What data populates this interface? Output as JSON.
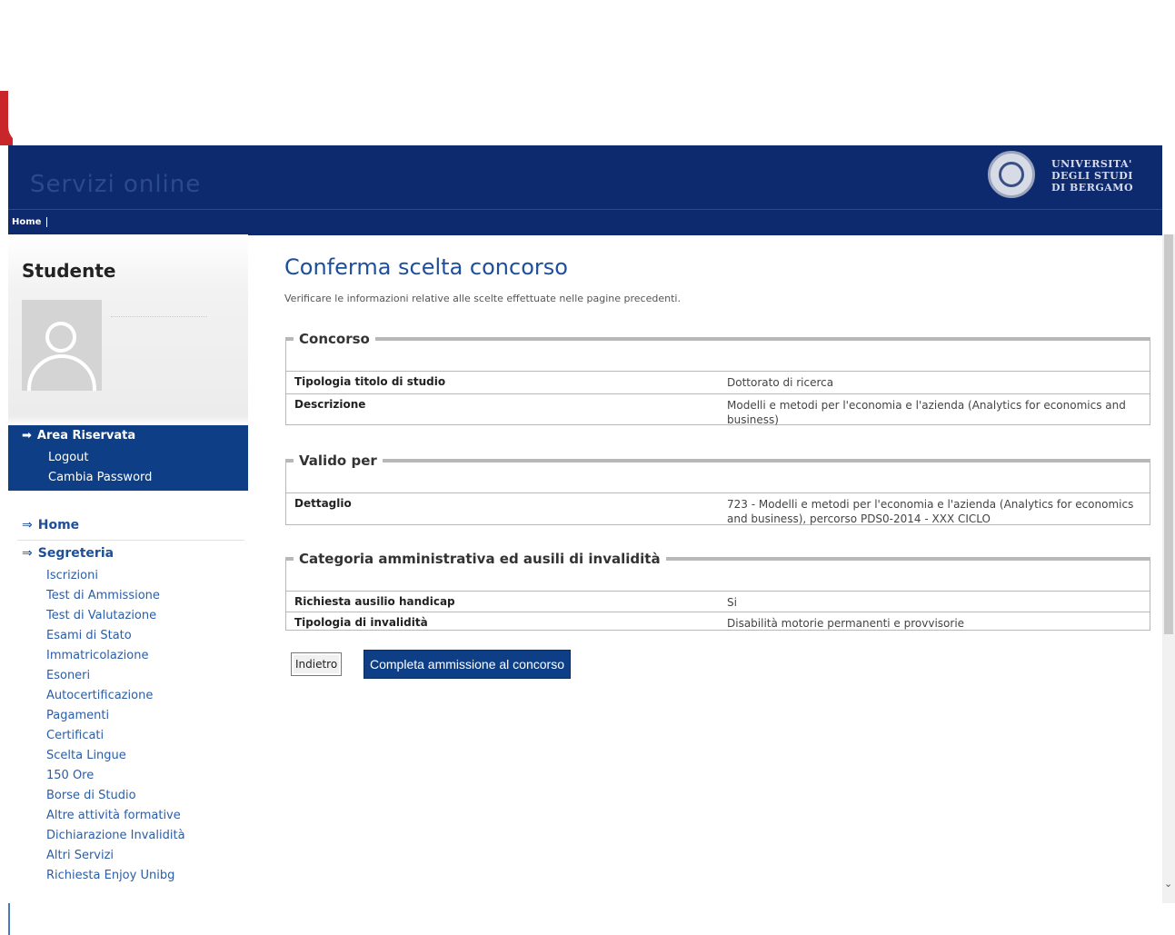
{
  "header": {
    "site_title": "Servizi online",
    "logo_lines": [
      "UNIVERSITA'",
      "DEGLI STUDI",
      "DI BERGAMO"
    ]
  },
  "navbar": {
    "home_label": "Home"
  },
  "sidebar": {
    "title": "Studente",
    "area": {
      "title": "Area Riservata",
      "links": [
        "Logout",
        "Cambia Password"
      ]
    },
    "home_label": "Home",
    "segreteria": {
      "title": "Segreteria",
      "links": [
        "Iscrizioni",
        "Test di Ammissione",
        "Test di Valutazione",
        "Esami di Stato",
        "Immatricolazione",
        "Esoneri",
        "Autocertificazione",
        "Pagamenti",
        "Certificati",
        "Scelta Lingue",
        "150 Ore",
        "Borse di Studio",
        "Altre attività formative",
        "Dichiarazione Invalidità",
        "Altri Servizi",
        "Richiesta Enjoy Unibg"
      ]
    }
  },
  "main": {
    "title": "Conferma scelta concorso",
    "subtitle": "Verificare le informazioni relative alle scelte effettuate nelle pagine precedenti.",
    "sections": [
      {
        "legend": "Concorso",
        "rows": [
          {
            "key": "Tipologia titolo di studio",
            "value": "Dottorato di ricerca"
          },
          {
            "key": "Descrizione",
            "value": "Modelli e metodi per l'economia e l'azienda (Analytics for economics and business)"
          }
        ]
      },
      {
        "legend": "Valido per",
        "rows": [
          {
            "key": "Dettaglio",
            "value": "723 - Modelli e metodi per l'economia e l'azienda (Analytics for economics and business), percorso PDS0-2014 - XXX CICLO"
          }
        ]
      },
      {
        "legend": "Categoria amministrativa ed ausili di invalidità",
        "rows": [
          {
            "key": "Richiesta ausilio handicap",
            "value": "Si"
          },
          {
            "key": "Tipologia di invalidità",
            "value": "Disabilità motorie permanenti e provvisorie"
          }
        ]
      }
    ],
    "buttons": {
      "back": "Indietro",
      "confirm": "Completa ammissione al concorso"
    }
  },
  "colors": {
    "brand": "#0e2a6e",
    "accent": "#0e3f86",
    "link": "#2b5da6"
  }
}
